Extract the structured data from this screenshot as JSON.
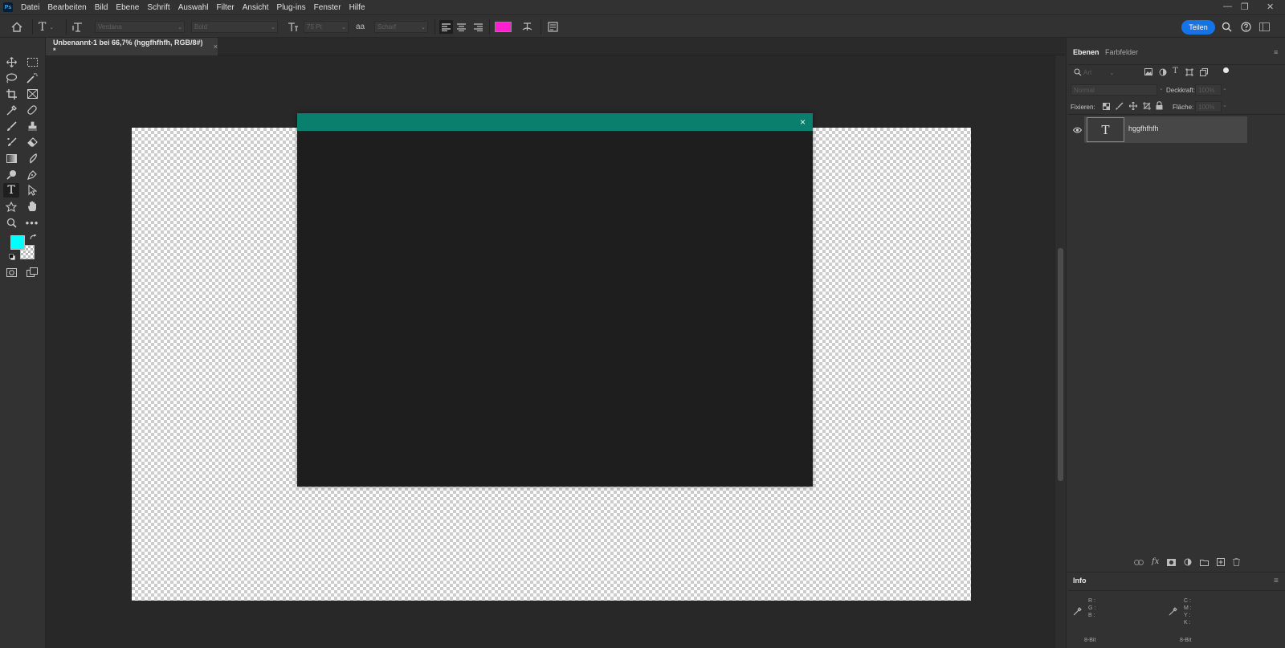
{
  "menubar": {
    "logo": "Ps",
    "items": [
      "Datei",
      "Bearbeiten",
      "Bild",
      "Ebene",
      "Schrift",
      "Auswahl",
      "Filter",
      "Ansicht",
      "Plug-ins",
      "Fenster",
      "Hilfe"
    ],
    "window_controls": {
      "minimize": "—",
      "restore": "❐",
      "close": "✕"
    }
  },
  "options_bar": {
    "font_family": "Verdana",
    "font_style": "Bold",
    "font_size": "75 Pt",
    "antialias_glyph": "aa",
    "antialias": "Scharf",
    "text_color": "#ff1fd0",
    "share_label": "Teilen"
  },
  "toolbar": {
    "foreground_color": "#00ffff",
    "background_color": "checker"
  },
  "document": {
    "tab_title": "Unbenannt-1 bei 66,7% (hggfhfhfh, RGB/8#) *",
    "tab_close": "×"
  },
  "dialog": {
    "header_color": "#0a7f6e",
    "close_glyph": "×"
  },
  "layers_panel": {
    "tabs": [
      "Ebenen",
      "Farbfelder"
    ],
    "filter_placeholder": "Art",
    "blend_mode": "Normal",
    "opacity_label": "Deckkraft:",
    "opacity_value": "100%",
    "lock_label": "Fixieren:",
    "fill_label": "Fläche:",
    "fill_value": "100%",
    "layers": [
      {
        "name": "hggfhfhfh",
        "thumb": "T",
        "visible": true
      }
    ]
  },
  "info_panel": {
    "title": "Info",
    "rgb_labels": "R :\nG :\nB :",
    "cmyk_labels": "C :\nM :\nY :\nK :",
    "bit_left": "8-Bit",
    "bit_right": "8-Bit"
  }
}
